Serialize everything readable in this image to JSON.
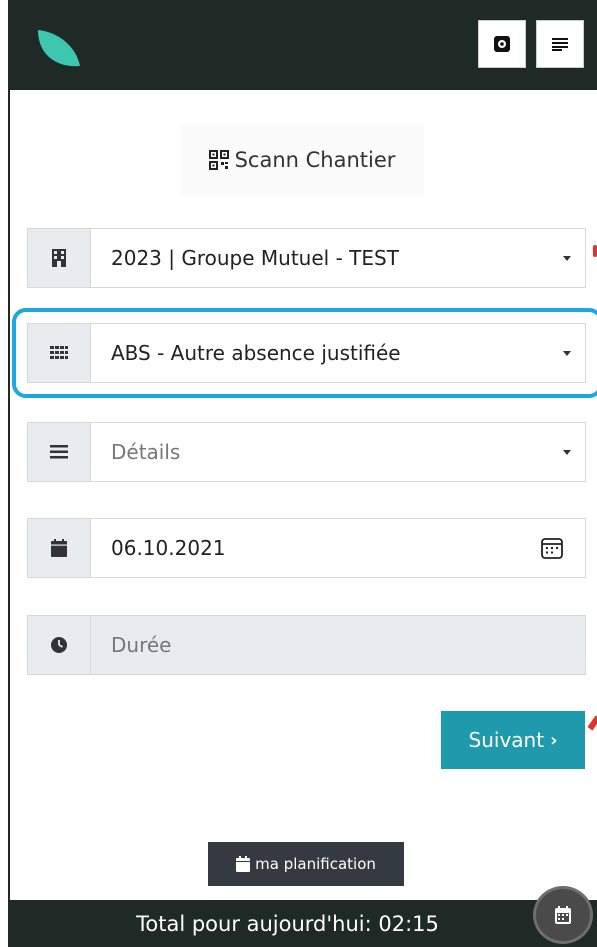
{
  "colors": {
    "topbar": "#1f2a27",
    "logo": "#3ec7b0",
    "accent_button": "#1f9aac",
    "highlight": "#1aa8e0",
    "addon_bg": "#e9ecef",
    "dark_button": "#343a40"
  },
  "header": {
    "settings_icon": "gear-icon",
    "menu_icon": "menu-icon"
  },
  "scan": {
    "icon": "qr-code-icon",
    "label": "Scann Chantier"
  },
  "form": {
    "project": {
      "icon": "building-icon",
      "value": "2023 | Groupe Mutuel - TEST"
    },
    "category": {
      "icon": "grid-icon",
      "value": "ABS - Autre absence justifiée"
    },
    "details": {
      "icon": "list-icon",
      "placeholder": "Détails"
    },
    "date": {
      "icon": "calendar-icon",
      "value": "06.10.2021"
    },
    "duration": {
      "icon": "clock-icon",
      "placeholder": "Durée"
    }
  },
  "actions": {
    "next_label": "Suivant",
    "planning_label": "ma planification"
  },
  "footer": {
    "total_text": "Total pour aujourd'hui: 02:15"
  }
}
